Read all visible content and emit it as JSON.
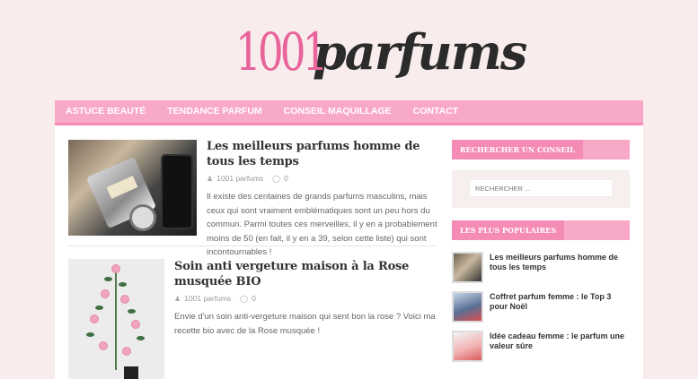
{
  "logo": {
    "number": "1001",
    "word": "parfums"
  },
  "nav": {
    "items": [
      {
        "label": "ASTUCE BEAUTÉ"
      },
      {
        "label": "TENDANCE PARFUM"
      },
      {
        "label": "CONSEIL MAQUILLAGE"
      },
      {
        "label": "CONTACT"
      }
    ]
  },
  "posts": [
    {
      "title": "Les meilleurs parfums homme de tous les temps",
      "author": "1001 parfums",
      "comments": "0",
      "excerpt": "Il existe des centaines de grands parfums masculins, mais ceux qui sont vraiment emblématiques sont un peu hors du commun. Parmi toutes ces merveilles, il y en a probablement moins de 50 (en fait, il y en a 39, selon cette liste) qui sont incontournables !"
    },
    {
      "title": "Soin anti vergeture maison à la Rose musquée BIO",
      "author": "1001 parfums",
      "comments": "0",
      "excerpt": "Envie d'un soin anti-vergeture maison qui sent bon la rose ? Voici ma recette bio avec de la Rose musquée !"
    }
  ],
  "sidebar": {
    "search_heading": "RECHERCHER UN CONSEIL",
    "search_placeholder": "RECHERCHER ...",
    "popular_heading": "LES PLUS POPULAIRES",
    "popular": [
      {
        "title": "Les meilleurs parfums homme de tous les temps"
      },
      {
        "title": "Coffret parfum femme : le Top 3 pour Noël"
      },
      {
        "title": "Idée cadeau femme : le parfum une valeur sûre"
      }
    ]
  },
  "icons": {
    "author": "user-icon",
    "comments": "comment-icon"
  },
  "colors": {
    "nav_bg": "#f9a9c8",
    "accent": "#f58cb5",
    "logo_pink": "#e8649a",
    "page_bg": "#f9ecec"
  }
}
